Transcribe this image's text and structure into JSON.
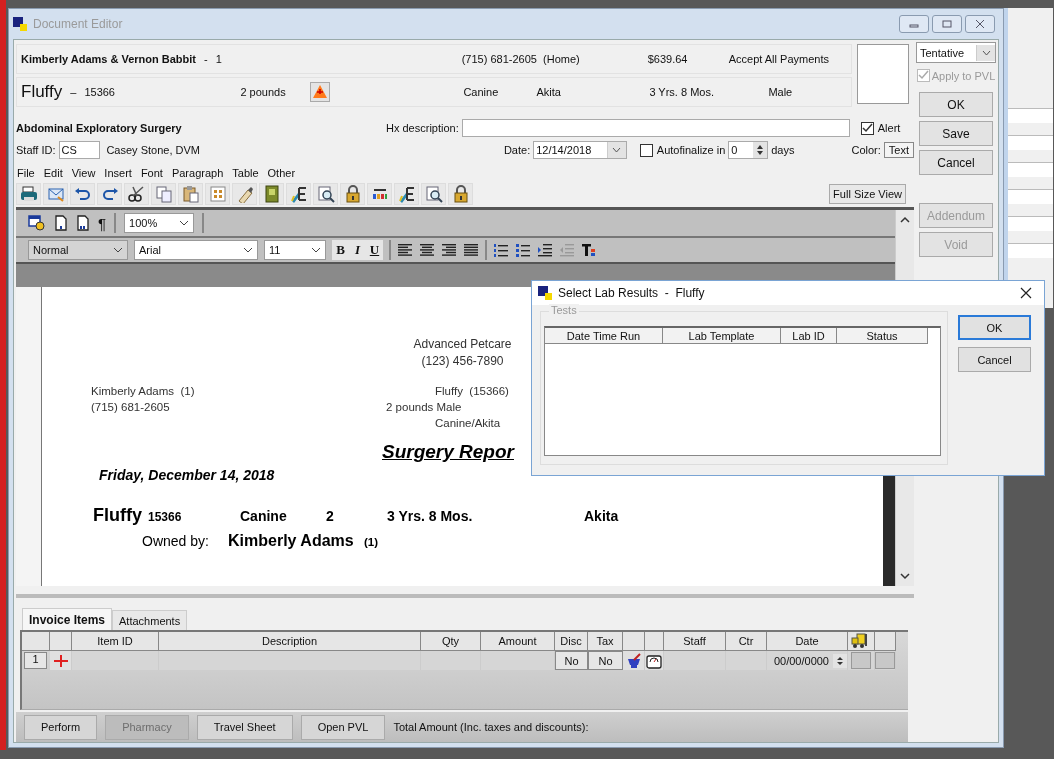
{
  "window": {
    "title": "Document Editor"
  },
  "client": {
    "name": "Kimberly Adams & Vernon Babbit",
    "separator": "-",
    "number": "1",
    "phone": "(715) 681-2605  (Home)",
    "balance": "$639.64",
    "payment_policy": "Accept All Payments"
  },
  "patient": {
    "name": "Fluffy",
    "separator": "–",
    "id": "15366",
    "weight": "2 pounds",
    "species": "Canine",
    "breed": "Akita",
    "age": "3 Yrs. 8 Mos.",
    "sex": "Male"
  },
  "status_dropdown": {
    "value": "Tentative"
  },
  "apply_to_pvl": {
    "label": "Apply to PVL",
    "checked": true,
    "disabled": true
  },
  "side_buttons": [
    {
      "label": "OK",
      "disabled": false
    },
    {
      "label": "Save",
      "disabled": false
    },
    {
      "label": "Cancel",
      "disabled": false
    },
    {
      "label": "Addendum",
      "disabled": true
    },
    {
      "label": "Void",
      "disabled": true
    }
  ],
  "document_title": "Abdominal Exploratory Surgery",
  "hx_description": {
    "label": "Hx description:"
  },
  "alert": {
    "label": "Alert",
    "checked": true
  },
  "staff": {
    "label": "Staff ID:",
    "value": "CS",
    "name": "Casey Stone, DVM"
  },
  "date": {
    "label": "Date:",
    "value": "12/14/2018"
  },
  "autofinalize": {
    "label": "Autofinalize in",
    "checked": false,
    "value": "0",
    "unit": "days"
  },
  "color": {
    "label": "Color:",
    "value": "Text"
  },
  "menu": [
    "File",
    "Edit",
    "View",
    "Insert",
    "Font",
    "Paragraph",
    "Table",
    "Other"
  ],
  "full_size_view": "Full Size View",
  "editor_toolbar": {
    "pilcrow": "¶",
    "zoom": "100%",
    "style": "Normal",
    "font": "Arial",
    "size": "11",
    "format_buttons": [
      "B",
      "I",
      "U"
    ]
  },
  "document": {
    "clinic": "Advanced Petcare",
    "clinic_phone": "(123) 456-7890",
    "owner": "Kimberly Adams  (1)",
    "owner_phone": "(715) 681-2605",
    "patient": "Fluffy  (15366)",
    "patient_weight_sex": "2 pounds Male",
    "patient_species_breed": "Canine/Akita",
    "title": "Surgery Repor",
    "date": "Friday, December 14, 2018",
    "summary": {
      "name": "Fluffy",
      "id": "15366",
      "species": "Canine",
      "weight": "2",
      "age": "3 Yrs. 8 Mos.",
      "breed": "Akita"
    },
    "owned_by_label": "Owned by:",
    "owner_name": "Kimberly Adams",
    "owner_number": "(1)"
  },
  "lab_dialog": {
    "title": "Select Lab Results  -  Fluffy",
    "group": "Tests",
    "columns": [
      "Date Time Run",
      "Lab Template",
      "Lab ID",
      "Status"
    ],
    "buttons": [
      {
        "label": "OK",
        "default": true
      },
      {
        "label": "Cancel",
        "default": false
      }
    ]
  },
  "bottom_tabs": [
    {
      "label": "Invoice Items",
      "selected": true
    },
    {
      "label": "Attachments",
      "selected": false
    }
  ],
  "invoice": {
    "columns": [
      {
        "kind": "blank"
      },
      {
        "kind": "blank"
      },
      {
        "kind": "text",
        "label": "Item ID"
      },
      {
        "kind": "text",
        "label": "Description"
      },
      {
        "kind": "text",
        "label": "Qty"
      },
      {
        "kind": "text",
        "label": "Amount"
      },
      {
        "kind": "text",
        "label": "Disc"
      },
      {
        "kind": "text",
        "label": "Tax"
      },
      {
        "kind": "blank"
      },
      {
        "kind": "blank"
      },
      {
        "kind": "text",
        "label": "Staff"
      },
      {
        "kind": "text",
        "label": "Ctr"
      },
      {
        "kind": "text",
        "label": "Date"
      },
      {
        "kind": "truck"
      },
      {
        "kind": "blank"
      }
    ],
    "rows": [
      {
        "cells": [
          {
            "kind": "number",
            "text": "1"
          },
          {
            "kind": "add"
          },
          {
            "kind": "empty"
          },
          {
            "kind": "empty"
          },
          {
            "kind": "empty"
          },
          {
            "kind": "empty"
          },
          {
            "kind": "toggle",
            "text": "No"
          },
          {
            "kind": "toggle",
            "text": "No"
          },
          {
            "kind": "mortar"
          },
          {
            "kind": "scale"
          },
          {
            "kind": "empty"
          },
          {
            "kind": "empty"
          },
          {
            "kind": "date",
            "text": "00/00/0000"
          },
          {
            "kind": "button"
          },
          {
            "kind": "button"
          }
        ]
      }
    ]
  },
  "footer_buttons": [
    {
      "label": "Perform",
      "disabled": false
    },
    {
      "label": "Pharmacy",
      "disabled": true
    },
    {
      "label": "Travel Sheet",
      "disabled": false
    },
    {
      "label": "Open PVL",
      "disabled": false
    }
  ],
  "total_label": "Total Amount (Inc. taxes and discounts):"
}
